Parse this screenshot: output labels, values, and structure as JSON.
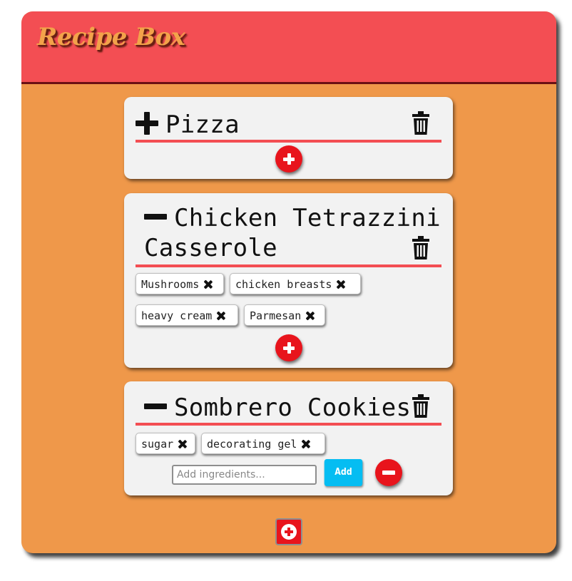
{
  "app": {
    "title": "Recipe Box"
  },
  "recipes": [
    {
      "name": "Pizza",
      "expanded": false,
      "toggle_icon": "plus-icon",
      "ingredients": []
    },
    {
      "name": "Chicken Tetrazzini Casserole",
      "name_line1": "Chicken Tetrazzini",
      "name_line2": "Casserole",
      "expanded": true,
      "toggle_icon": "minus-icon",
      "ingredients": [
        "Mushrooms",
        "chicken breasts",
        "heavy cream",
        "Parmesan"
      ]
    },
    {
      "name": "Sombrero Cookies",
      "expanded": true,
      "toggle_icon": "minus-icon",
      "ingredients": [
        "sugar",
        "decorating gel"
      ],
      "add_form": {
        "placeholder": "Add ingredients...",
        "value": "",
        "button_label": "Add"
      }
    }
  ],
  "icons": {
    "delete": "trash-icon",
    "add_ingredient": "plus-circle-icon",
    "close_form": "minus-circle-icon",
    "remove_ingredient": "close-icon",
    "new_recipe": "plus-square-icon"
  },
  "colors": {
    "header": "#f34e53",
    "background": "#ef984a",
    "card": "#f2f2f2",
    "accent_red": "#e8141c",
    "add_button": "#05bdf2"
  }
}
